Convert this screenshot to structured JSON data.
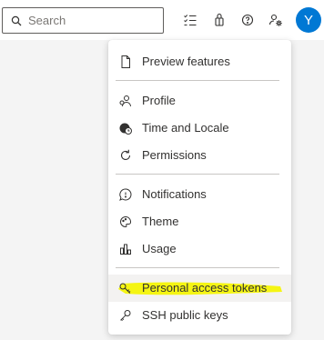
{
  "search": {
    "placeholder": "Search",
    "value": ""
  },
  "header": {
    "avatar_initial": "Y",
    "accent_color": "#0078d4"
  },
  "toolbar_icons": [
    "checklist-icon",
    "shopping-bag-icon",
    "help-icon",
    "user-settings-icon"
  ],
  "menu": {
    "items": [
      {
        "label": "Preview features",
        "icon": "document-icon"
      },
      {
        "label": "Profile",
        "icon": "profile-icon"
      },
      {
        "label": "Time and Locale",
        "icon": "globe-clock-icon"
      },
      {
        "label": "Permissions",
        "icon": "refresh-icon"
      },
      {
        "label": "Notifications",
        "icon": "comment-icon"
      },
      {
        "label": "Theme",
        "icon": "palette-icon"
      },
      {
        "label": "Usage",
        "icon": "bar-chart-icon"
      },
      {
        "label": "Personal access tokens",
        "icon": "key-icon"
      },
      {
        "label": "SSH public keys",
        "icon": "ssh-key-icon"
      }
    ],
    "highlight_color": "#f5f500"
  }
}
